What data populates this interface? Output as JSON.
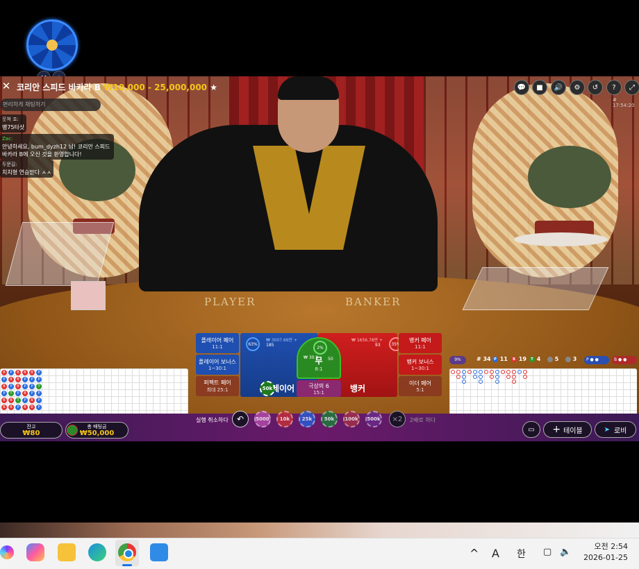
{
  "header": {
    "title": "코리안 스피드 바카라 B",
    "range": "₩10,000 - 25,000,000"
  },
  "clock": "# 17:54:20",
  "chat": {
    "placeholder": "편리하게 채팅하기",
    "messages": [
      {
        "user": "웃쳐 죠:",
        "text": "뱅75타삿",
        "color": "normal"
      },
      {
        "user": "Zac:",
        "text": "안녕하세요, bum_dyzh12 님! 코리안 스피드 바카라 B에 오신 것을 환영합니다!",
        "color": "green"
      },
      {
        "user": "두문길:",
        "text": "치치형 연승맏다 ㅅㅅ",
        "color": "normal"
      }
    ]
  },
  "table_labels": {
    "player": "PLAYER",
    "banker": "BANKER"
  },
  "bets": {
    "player_pair": {
      "label": "플레이어 페어",
      "odds": "11:1"
    },
    "player_bonus": {
      "label": "플레이어 보너스",
      "odds": "1~30:1"
    },
    "perfect_pair": {
      "label": "퍼펙트 페어",
      "odds": "최대 25:1"
    },
    "player": {
      "label": "플레이어",
      "amount": "₩ 3007.66만 +",
      "count": "185",
      "pct": "63%"
    },
    "tie": {
      "label": "무",
      "odds": "8:1",
      "amount": "₩ 30.9",
      "count": "50",
      "pct": "2%"
    },
    "super6": {
      "label": "극상의 6",
      "odds": "15:1"
    },
    "banker": {
      "label": "뱅커",
      "amount": "₩ 1656.78만 +",
      "count": "93",
      "pct": "35%"
    },
    "banker_pair": {
      "label": "뱅커 페어",
      "odds": "11:1"
    },
    "banker_bonus": {
      "label": "뱅커 보너스",
      "odds": "1~30:1"
    },
    "either_pair": {
      "label": "이더 페어",
      "odds": "5:1"
    },
    "placed_chip": "50k"
  },
  "stats": {
    "round": "# 34",
    "player_wins": "11",
    "banker_wins": "19",
    "ties": "4",
    "player_pairs": "5",
    "banker_pairs": "3",
    "tie_pct": "9%"
  },
  "bead_road": [
    [
      "B",
      "P",
      "B",
      "B",
      "B",
      "P"
    ],
    [
      "P",
      "B",
      "B",
      "P",
      "P",
      "P"
    ],
    [
      "B",
      "P",
      "B",
      "P",
      "P",
      "T"
    ],
    [
      "P",
      "T",
      "P",
      "B",
      "P",
      "P"
    ],
    [
      "B",
      "B",
      "T",
      "P",
      "B",
      "P"
    ],
    [
      "B",
      "B",
      "P",
      "B",
      "B",
      "P"
    ]
  ],
  "bottom": {
    "balance_label": "잔고",
    "balance": "₩80",
    "total_bet_label": "총 배팅금",
    "total_bet": "₩50,000",
    "undo_label": "실행 취소하다",
    "chips": [
      "5000",
      "10k",
      "25k",
      "50k",
      "100k",
      "500k"
    ],
    "double_label": "2배로 하다",
    "double_icon": "×2",
    "table_label": "테이블",
    "lobby_label": "로비"
  },
  "taskbar": {
    "tray_ime": "A",
    "tray_lang": "한",
    "time": "오전 2:54",
    "date": "2026-01-25"
  }
}
